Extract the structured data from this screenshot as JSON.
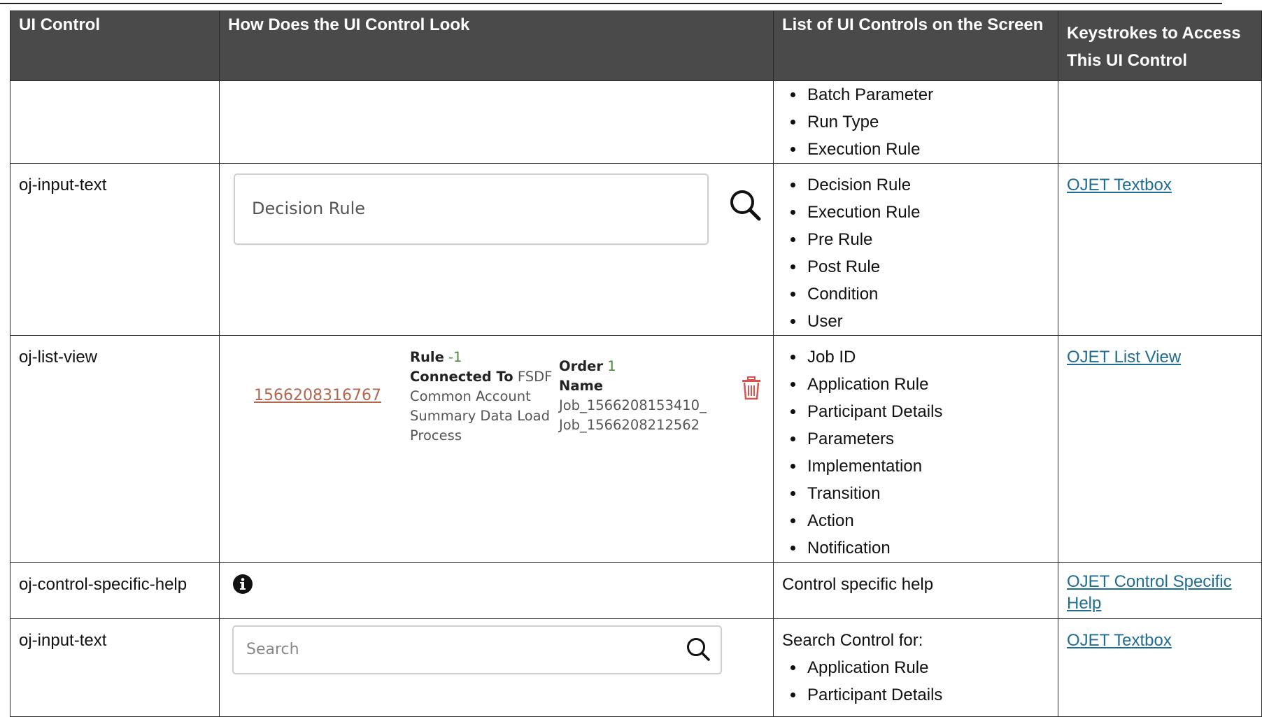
{
  "header": {
    "col1": "UI Control",
    "col2": "How Does the UI Control Look",
    "col3": "List of UI Controls on the Screen",
    "col4": "Keystrokes to Access This UI Control"
  },
  "rows": [
    {
      "control": "",
      "items": [
        "Batch Parameter",
        "Run Type",
        "Execution Rule"
      ],
      "link": ""
    },
    {
      "control": "oj-input-text",
      "mock_value": "Decision Rule",
      "icon": "search-icon",
      "items": [
        "Decision Rule",
        "Execution Rule",
        "Pre Rule",
        "Post Rule",
        "Condition",
        "User"
      ],
      "link": "OJET Textbox"
    },
    {
      "control": "oj-list-view",
      "list_item": {
        "job_id": "1566208316767",
        "rule_label": "Rule",
        "rule_value": "-1",
        "connected_label": "Connected To",
        "connected_value": "FSDF Common Account Summary Data Load Process",
        "order_label": "Order",
        "order_value": "1",
        "name_label": "Name",
        "name_value_1": "Job_1566208153410_",
        "name_value_2": "Job_1566208212562"
      },
      "icon": "trash-icon",
      "items": [
        "Job ID",
        "Application Rule",
        "Participant Details",
        "Parameters",
        "Implementation",
        "Transition",
        "Action",
        "Notification"
      ],
      "link": "OJET List View"
    },
    {
      "control": "oj-control-specific-help",
      "icon": "info-icon",
      "text": "Control specific help",
      "link_line1": "OJET Control Specific",
      "link_line2": "Help"
    },
    {
      "control": "oj-input-text",
      "placeholder": "Search",
      "icon": "search-icon",
      "intro": "Search Control for:",
      "items": [
        "Application Rule",
        "Participant Details"
      ],
      "link": "OJET Textbox"
    }
  ],
  "colors": {
    "header_bg": "#4a4a4a",
    "link": "#1f6d93",
    "job_id": "#b5654e",
    "trash": "#d9534f",
    "number": "#4b8b3b"
  }
}
